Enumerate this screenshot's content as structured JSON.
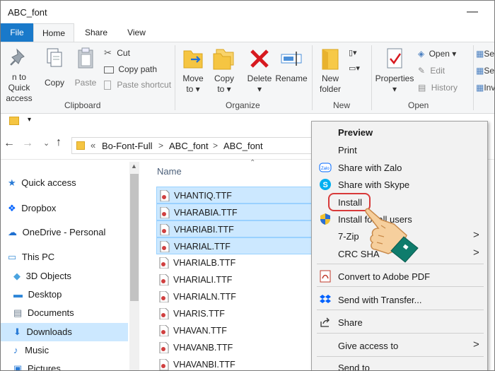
{
  "window": {
    "title": "ABC_font",
    "minimize_glyph": "—"
  },
  "tabs": {
    "file": "File",
    "home": "Home",
    "share": "Share",
    "view": "View"
  },
  "ribbon": {
    "clipboard": {
      "pin_line1": "n to Quick",
      "pin_line2": "access",
      "copy": "Copy",
      "paste": "Paste",
      "cut": "Cut",
      "copy_path": "Copy path",
      "paste_shortcut": "Paste shortcut",
      "group": "Clipboard"
    },
    "organize": {
      "move_to": "Move",
      "move_to2": "to",
      "copy_to": "Copy",
      "copy_to2": "to",
      "delete": "Delete",
      "rename": "Rename",
      "group": "Organize"
    },
    "new": {
      "new_folder": "New",
      "new_folder2": "folder",
      "group": "New"
    },
    "open": {
      "properties": "Properties",
      "open": "Open",
      "edit": "Edit",
      "history": "History",
      "group": "Open"
    },
    "select": {
      "s1": "Sel",
      "s2": "Sel",
      "s3": "Inv"
    }
  },
  "address": {
    "chevrons": "«",
    "crumbs": [
      "Bo-Font-Full",
      "ABC_font",
      "ABC_font"
    ],
    "sep": ">"
  },
  "nav": {
    "quick_access": "Quick access",
    "dropbox": "Dropbox",
    "onedrive": "OneDrive - Personal",
    "this_pc": "This PC",
    "objects3d": "3D Objects",
    "desktop": "Desktop",
    "documents": "Documents",
    "downloads": "Downloads",
    "music": "Music",
    "pictures": "Pictures"
  },
  "files": {
    "header": "Name",
    "items": [
      "VHANTIQ.TTF",
      "VHARABIA.TTF",
      "VHARIABI.TTF",
      "VHARIAL.TTF",
      "VHARIALB.TTF",
      "VHARIALI.TTF",
      "VHARIALN.TTF",
      "VHARIS.TTF",
      "VHAVAN.TTF",
      "VHAVANB.TTF",
      "VHAVANBI.TTF"
    ]
  },
  "context_menu": {
    "preview": "Preview",
    "print": "Print",
    "zalo": "Share with Zalo",
    "skype": "Share with Skype",
    "install": "Install",
    "install_all": "Install for all users",
    "zip": "7-Zip",
    "crc": "CRC SHA",
    "pdf": "Convert to Adobe PDF",
    "transfer": "Send with Transfer...",
    "share": "Share",
    "give_access": "Give access to",
    "send_to": "Send to"
  },
  "colors": {
    "accent": "#1979ca",
    "selection": "#cce8ff",
    "ring": "#d83a3a"
  }
}
